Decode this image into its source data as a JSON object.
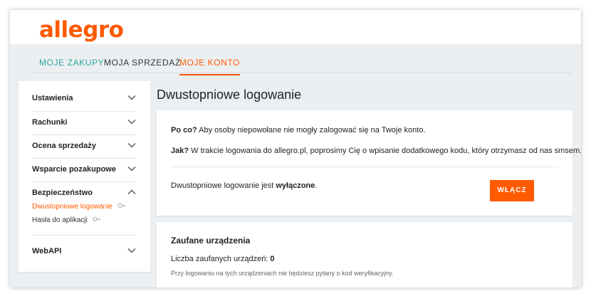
{
  "header": {
    "logo_text": "allegro"
  },
  "nav": {
    "tabs": [
      {
        "label": "MOJE ZAKUPY"
      },
      {
        "label": "MOJA SPRZEDAŻ"
      },
      {
        "label": "MOJE KONTO",
        "active": true
      }
    ]
  },
  "sidebar": {
    "items": [
      {
        "label": "Ustawienia",
        "icon": "chevron-down-icon"
      },
      {
        "label": "Rachunki",
        "icon": "chevron-down-icon"
      },
      {
        "label": "Ocena sprzedaży",
        "icon": "chevron-down-icon"
      },
      {
        "label": "Wsparcie pozakupowe",
        "icon": "chevron-down-icon"
      },
      {
        "label": "Bezpieczeństwo",
        "icon": "chevron-up-icon",
        "expanded": true
      },
      {
        "label": "WebAPI",
        "icon": "chevron-down-icon"
      }
    ],
    "sub_items": [
      {
        "label": "Dwustopniowe logowanie",
        "active": true,
        "icon": "key-icon"
      },
      {
        "label": "Hasła do aplikacji",
        "icon": "key-icon"
      }
    ]
  },
  "main": {
    "title": "Dwustopniowe logowanie",
    "card1": {
      "why_label": "Po co?",
      "why_text": " Aby osoby niepowołane nie mogły zalogować się na Twoje konto.",
      "how_label": "Jak?",
      "how_text": " W trakcie logowania do allegro.pl, poprosimy Cię o wpisanie dodatkowego kodu, który otrzymasz od nas smsem.",
      "status_prefix": "Dwustopniowe logowanie jest ",
      "status_value": "wyłączone",
      "status_suffix": ".",
      "enable_button": "WŁĄCZ"
    },
    "card2": {
      "title": "Zaufane urządzenia",
      "count_label": "Liczba zaufanych urządzeń: ",
      "count_value": "0",
      "note": "Przy logowaniu na tych urządzeniach nie będziesz pytany o kod weryfikacyjny."
    }
  },
  "colors": {
    "brand": "#ff5a00",
    "teal": "#2ea6a0",
    "background": "#eceff1"
  }
}
